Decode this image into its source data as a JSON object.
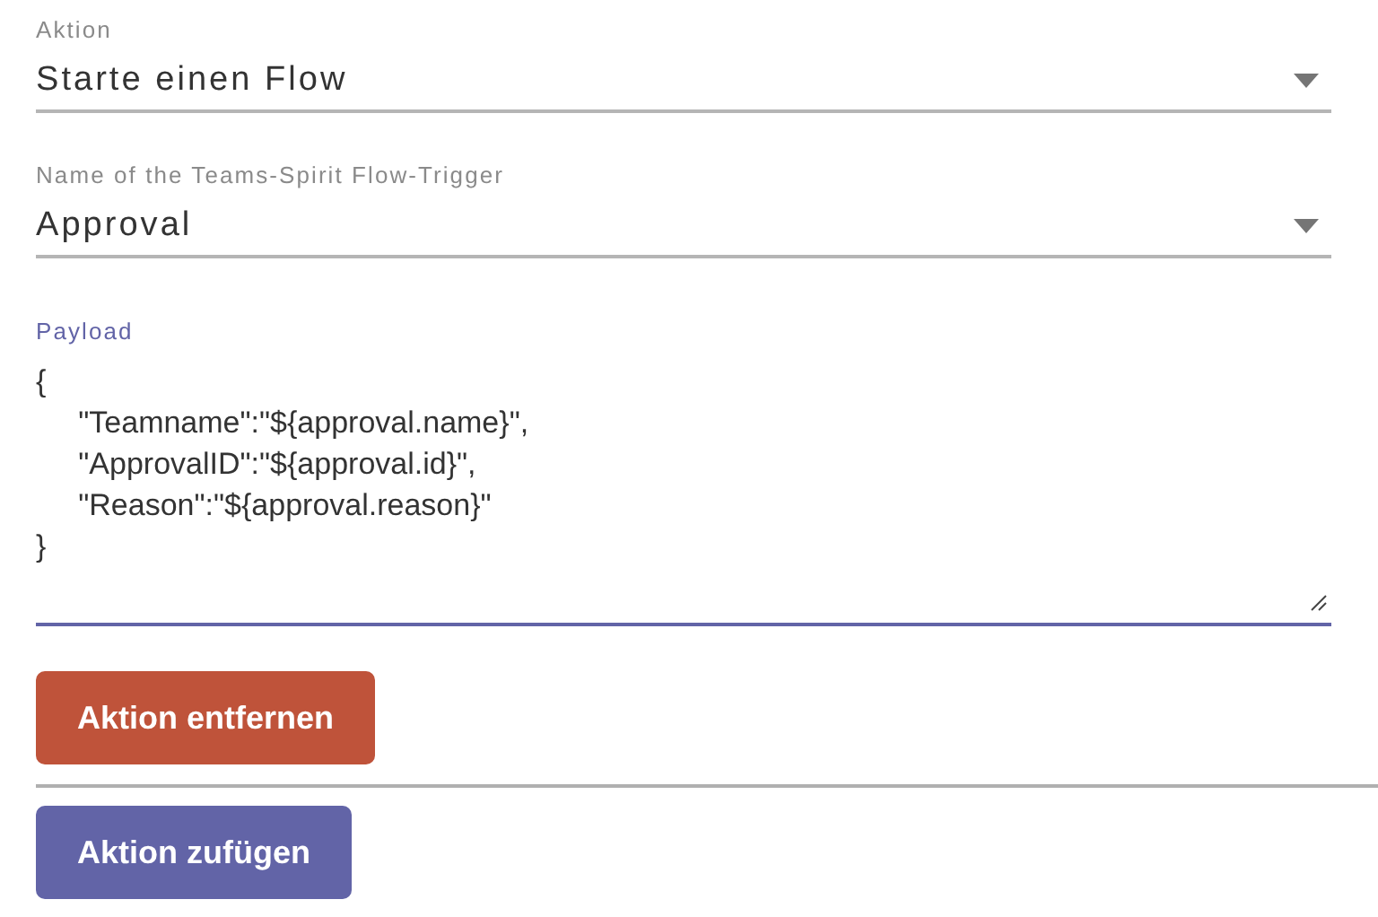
{
  "fields": [
    {
      "kind": "select",
      "label": "Aktion",
      "value": "Starte einen Flow",
      "focused": false
    },
    {
      "kind": "select",
      "label": "Name of the Teams-Spirit Flow-Trigger",
      "value": "Approval",
      "focused": false
    },
    {
      "kind": "textarea",
      "label": "Payload",
      "value": "{\n\t\"Teamname\":\"${approval.name}\",\n\t\"ApprovalID\":\"${approval.id}\",\n\t\"Reason\":\"${approval.reason}\"\n}",
      "focused": true
    }
  ],
  "buttons": [
    {
      "label": "Aktion entfernen",
      "color": "#bf533a"
    },
    {
      "label": "Aktion zufügen",
      "color": "#6264a7"
    }
  ]
}
